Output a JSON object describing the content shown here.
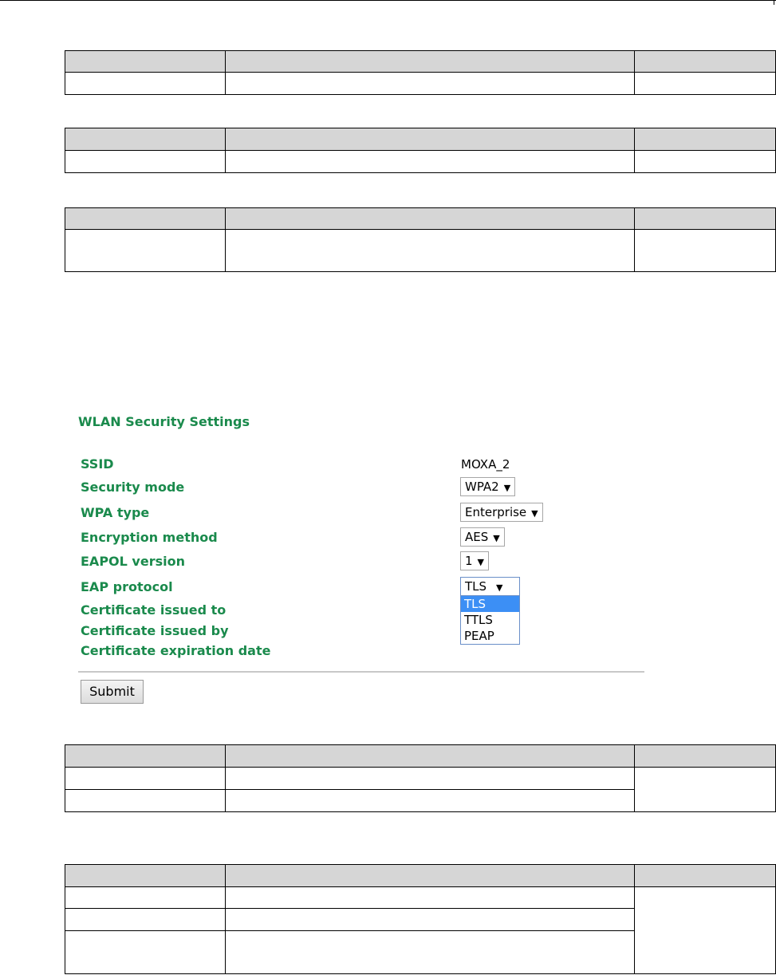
{
  "wlan_security": {
    "title": "WLAN Security Settings",
    "fields": {
      "ssid": {
        "label": "SSID",
        "value": "MOXA_2"
      },
      "security_mode": {
        "label": "Security mode",
        "value": "WPA2"
      },
      "wpa_type": {
        "label": "WPA type",
        "value": "Enterprise"
      },
      "encryption_method": {
        "label": "Encryption method",
        "value": "AES"
      },
      "eapol_version": {
        "label": "EAPOL version",
        "value": "1"
      },
      "eap_protocol": {
        "label": "EAP protocol",
        "value": "TLS",
        "options": [
          "TLS",
          "TTLS",
          "PEAP"
        ]
      },
      "cert_issued_to": {
        "label": "Certificate issued to"
      },
      "cert_issued_by": {
        "label": "Certificate issued by"
      },
      "cert_expiration": {
        "label": "Certificate expiration date"
      }
    },
    "submit_label": "Submit",
    "dropdown_arrow": "▼"
  }
}
